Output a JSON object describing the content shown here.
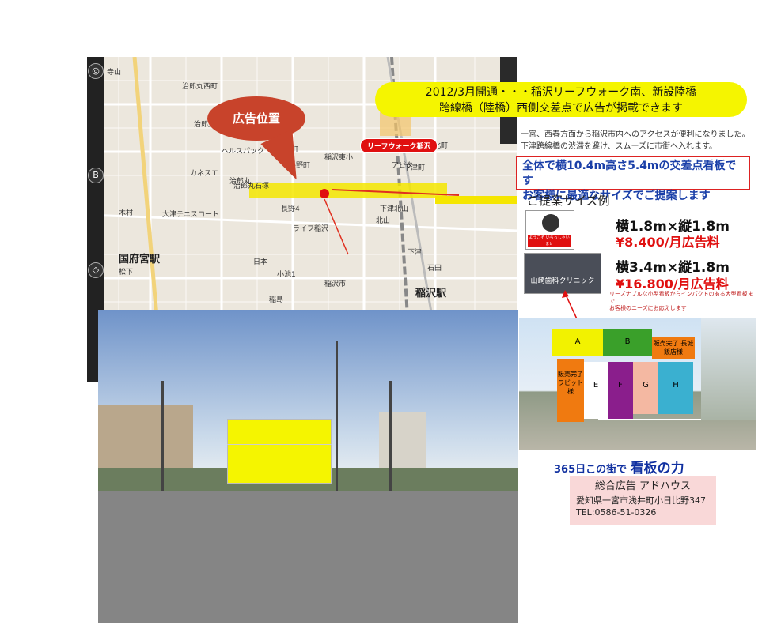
{
  "map": {
    "callout": "広告位置",
    "leafwalk_label": "リーフウォーク稲沢",
    "stations": [
      "国府宮駅",
      "稲沢駅"
    ],
    "labels": [
      "寺山",
      "治郎丸西町",
      "治郎丸中町",
      "平和",
      "治郎丸",
      "治郎丸石塚",
      "稲沢町",
      "長野町",
      "大津テニスコート",
      "下津北山",
      "下津北町",
      "下津町",
      "ライフ稲沢",
      "木村",
      "松下",
      "長野4",
      "小池1",
      "日本",
      "稲沢市",
      "稲島",
      "北山",
      "下津",
      "石田",
      "ヘルスパック",
      "カネスエ",
      "アピタ",
      "稲沢東小"
    ]
  },
  "headline": {
    "line1": "2012/3月開通・・・稲沢リーフウォーク南、新設陸橋",
    "line2": "跨線橋（陸橋）西側交差点で広告が掲載できます"
  },
  "subtext": {
    "line1": "一宮、西春方面から稲沢市内へのアクセスが便利になりました。",
    "line2": "下津跨線橋の渋滞を避け、スムーズに市街へ入れます。"
  },
  "highlight": {
    "line1": "全体で横10.4m高さ5.4mの交差点看板です",
    "line2": "お客様に最適なサイズでご提案します"
  },
  "sizes": {
    "title": "ご提案サイズ例",
    "items": [
      {
        "thumb_text": "ようこそ いらっしゃいませ",
        "dims": "横1.8m×縦1.8m",
        "price": "¥8.400/月広告料"
      },
      {
        "thumb_text": "山崎歯科クリニック",
        "dims": "横3.4m×縦1.8m",
        "price": "¥16.800/月広告料"
      }
    ],
    "note_line1": "リーズナブルな小型看板からインパクトのある大型看板まで",
    "note_line2": "お客様のニーズにお応えします"
  },
  "billboard": {
    "panels": [
      "A",
      "B",
      "販売完了 長城飯店様",
      "販売完了 ラビット様",
      "E",
      "F",
      "G",
      "H"
    ],
    "colors": {
      "A": "#f2f200",
      "B": "#3aa02a",
      "C": "#f07a10",
      "D": "#f07a10",
      "E": "#ffffff",
      "F": "#8a1e8c",
      "G": "#f4b8a2",
      "H": "#3ab0d0"
    }
  },
  "tagline": {
    "prefix": "365日この街で",
    "main": "看板の力"
  },
  "company": {
    "name": "総合広告 アドハウス",
    "address": "愛知県一宮市浅井町小日比野347",
    "tel": "TEL:0586-51-0326"
  },
  "colors": {
    "headline_bg": "#f5f500",
    "accent_red": "#e01010",
    "highlight_blue": "#1a3fa8",
    "callout": "#c8432b",
    "company_bg": "#f9d8d8"
  }
}
